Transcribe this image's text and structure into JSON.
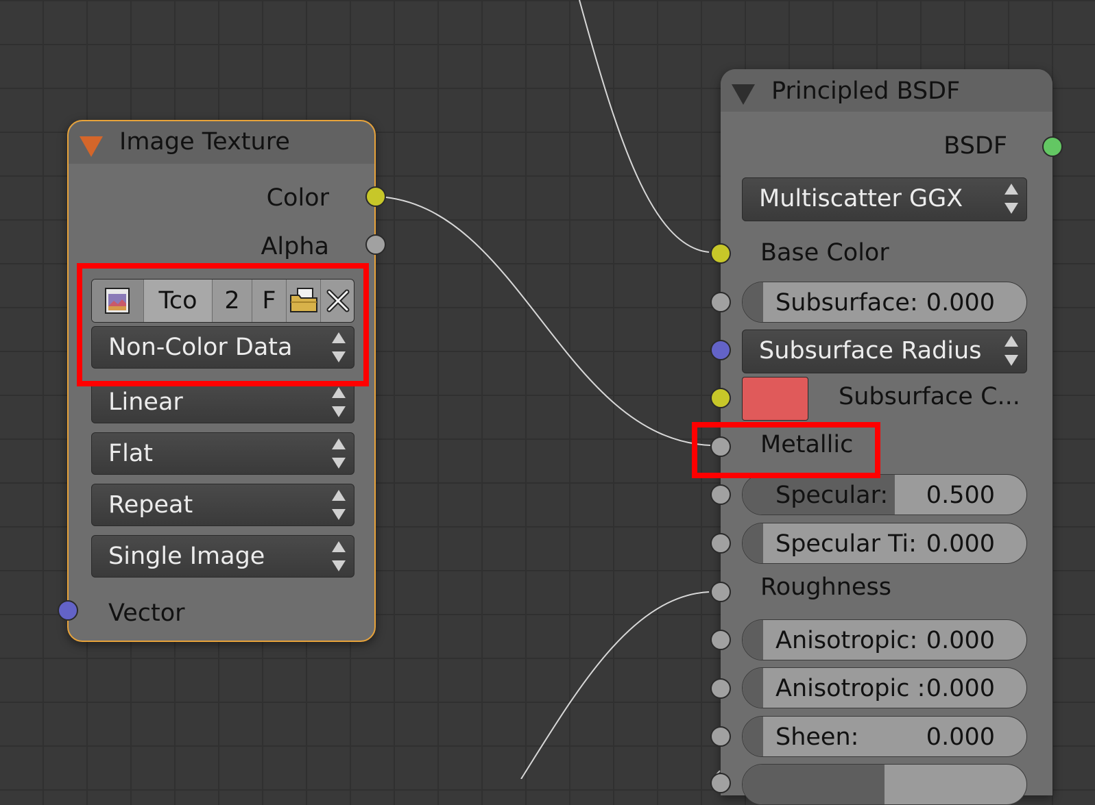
{
  "image_texture": {
    "title": "Image Texture",
    "outputs": {
      "color": "Color",
      "alpha": "Alpha"
    },
    "image_bar": {
      "name": "Tco",
      "users": "2",
      "fake_user": "F"
    },
    "color_space": "Non-Color Data",
    "interpolation": "Linear",
    "projection": "Flat",
    "extension": "Repeat",
    "source": "Single Image",
    "inputs": {
      "vector": "Vector"
    }
  },
  "principled_bsdf": {
    "title": "Principled BSDF",
    "output": "BSDF",
    "distribution": "Multiscatter GGX",
    "base_color": "Base Color",
    "subsurface": {
      "label": "Subsurface:",
      "value": "0.000",
      "fraction": 0
    },
    "subsurface_method": "Subsurface Radius",
    "subsurface_color": {
      "label": "Subsurface C...",
      "color": "#e05a5a"
    },
    "metallic": "Metallic",
    "specular": {
      "label": "Specular:",
      "value": "0.500",
      "fraction": 0.5
    },
    "specular_tint": {
      "label": "Specular Ti:",
      "value": "0.000",
      "fraction": 0
    },
    "roughness": "Roughness",
    "anisotropic": {
      "label": "Anisotropic:",
      "value": "0.000",
      "fraction": 0
    },
    "anisotropic_rotation": {
      "label": "Anisotropic :",
      "value": "0.000",
      "fraction": 0
    },
    "sheen": {
      "label": "Sheen:",
      "value": "0.000",
      "fraction": 0
    }
  },
  "colors": {
    "socket_color": "#c7c729",
    "socket_float": "#a1a1a1",
    "socket_vector": "#6363c7",
    "socket_shader": "#63c763",
    "highlight": "#ff0000",
    "selected_outline": "#e8a33a"
  }
}
